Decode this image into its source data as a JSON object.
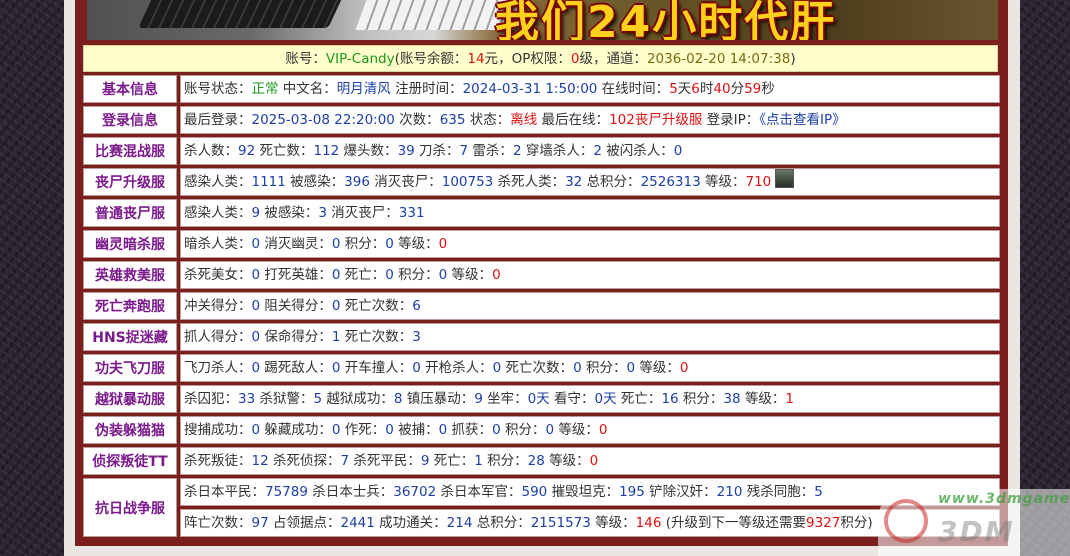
{
  "banner": {
    "text": "我们24小时代肝"
  },
  "account": {
    "prefix": "账号：",
    "id": "VIP-Candy",
    "balance_label": "(账号余额：",
    "balance": "14",
    "balance_unit": "元，OP权限：",
    "op": "0",
    "op_unit": "级，通道：",
    "channel": "2036-02-20 14:07:38",
    "suffix": ")"
  },
  "rows": [
    {
      "label": "基本信息",
      "lines": [
        [
          {
            "t": "账号状态："
          },
          {
            "t": "正常",
            "c": "green"
          },
          {
            "t": " 中文名："
          },
          {
            "t": "明月清风",
            "c": "blue"
          },
          {
            "t": " 注册时间："
          },
          {
            "t": "2024-03-31 1:50:00",
            "c": "blue"
          },
          {
            "t": " 在线时间："
          },
          {
            "t": "5",
            "c": "red"
          },
          {
            "t": "天"
          },
          {
            "t": "6",
            "c": "red"
          },
          {
            "t": "时"
          },
          {
            "t": "40",
            "c": "red"
          },
          {
            "t": "分"
          },
          {
            "t": "59",
            "c": "red"
          },
          {
            "t": "秒"
          }
        ]
      ]
    },
    {
      "label": "登录信息",
      "lines": [
        [
          {
            "t": "最后登录："
          },
          {
            "t": "2025-03-08 22:20:00",
            "c": "blue"
          },
          {
            "t": " 次数："
          },
          {
            "t": "635",
            "c": "blue"
          },
          {
            "t": " 状态："
          },
          {
            "t": "离线",
            "c": "red"
          },
          {
            "t": " 最后在线："
          },
          {
            "t": "102丧尸升级服",
            "c": "red"
          },
          {
            "t": " 登录IP："
          },
          {
            "t": "《点击查看IP》",
            "c": "link"
          }
        ]
      ]
    },
    {
      "label": "比赛混战服",
      "lines": [
        [
          {
            "t": "杀人数："
          },
          {
            "t": "92",
            "c": "blue"
          },
          {
            "t": " 死亡数："
          },
          {
            "t": "112",
            "c": "blue"
          },
          {
            "t": " 爆头数："
          },
          {
            "t": "39",
            "c": "blue"
          },
          {
            "t": " 刀杀："
          },
          {
            "t": "7",
            "c": "blue"
          },
          {
            "t": " 雷杀："
          },
          {
            "t": "2",
            "c": "blue"
          },
          {
            "t": " 穿墙杀人："
          },
          {
            "t": "2",
            "c": "blue"
          },
          {
            "t": " 被闪杀人："
          },
          {
            "t": "0",
            "c": "blue"
          }
        ]
      ]
    },
    {
      "label": "丧尸升级服",
      "avatar": true,
      "lines": [
        [
          {
            "t": "感染人类："
          },
          {
            "t": "1111",
            "c": "blue"
          },
          {
            "t": " 被感染："
          },
          {
            "t": "396",
            "c": "blue"
          },
          {
            "t": " 消灭丧尸："
          },
          {
            "t": "100753",
            "c": "blue"
          },
          {
            "t": " 杀死人类："
          },
          {
            "t": "32",
            "c": "blue"
          },
          {
            "t": " 总积分："
          },
          {
            "t": "2526313",
            "c": "blue"
          },
          {
            "t": " 等级："
          },
          {
            "t": "710",
            "c": "red"
          }
        ]
      ]
    },
    {
      "label": "普通丧尸服",
      "lines": [
        [
          {
            "t": "感染人类："
          },
          {
            "t": "9",
            "c": "blue"
          },
          {
            "t": " 被感染："
          },
          {
            "t": "3",
            "c": "blue"
          },
          {
            "t": " 消灭丧尸："
          },
          {
            "t": "331",
            "c": "blue"
          }
        ]
      ]
    },
    {
      "label": "幽灵暗杀服",
      "lines": [
        [
          {
            "t": "暗杀人类："
          },
          {
            "t": "0",
            "c": "blue"
          },
          {
            "t": " 消灭幽灵："
          },
          {
            "t": "0",
            "c": "blue"
          },
          {
            "t": " 积分："
          },
          {
            "t": "0",
            "c": "blue"
          },
          {
            "t": " 等级："
          },
          {
            "t": "0",
            "c": "red"
          }
        ]
      ]
    },
    {
      "label": "英雄救美服",
      "lines": [
        [
          {
            "t": "杀死美女："
          },
          {
            "t": "0",
            "c": "blue"
          },
          {
            "t": " 打死英雄："
          },
          {
            "t": "0",
            "c": "blue"
          },
          {
            "t": " 死亡："
          },
          {
            "t": "0",
            "c": "blue"
          },
          {
            "t": " 积分："
          },
          {
            "t": "0",
            "c": "blue"
          },
          {
            "t": " 等级："
          },
          {
            "t": "0",
            "c": "red"
          }
        ]
      ]
    },
    {
      "label": "死亡奔跑服",
      "lines": [
        [
          {
            "t": "冲关得分："
          },
          {
            "t": "0",
            "c": "blue"
          },
          {
            "t": " 阻关得分："
          },
          {
            "t": "0",
            "c": "blue"
          },
          {
            "t": " 死亡次数："
          },
          {
            "t": "6",
            "c": "blue"
          }
        ]
      ]
    },
    {
      "label": "HNS捉迷藏",
      "lines": [
        [
          {
            "t": "抓人得分："
          },
          {
            "t": "0",
            "c": "blue"
          },
          {
            "t": " 保命得分："
          },
          {
            "t": "1",
            "c": "blue"
          },
          {
            "t": " 死亡次数："
          },
          {
            "t": "3",
            "c": "blue"
          }
        ]
      ]
    },
    {
      "label": "功夫飞刀服",
      "lines": [
        [
          {
            "t": "飞刀杀人："
          },
          {
            "t": "0",
            "c": "blue"
          },
          {
            "t": " 踢死敌人："
          },
          {
            "t": "0",
            "c": "blue"
          },
          {
            "t": " 开车撞人："
          },
          {
            "t": "0",
            "c": "blue"
          },
          {
            "t": " 开枪杀人："
          },
          {
            "t": "0",
            "c": "blue"
          },
          {
            "t": " 死亡次数："
          },
          {
            "t": "0",
            "c": "blue"
          },
          {
            "t": " 积分："
          },
          {
            "t": "0",
            "c": "blue"
          },
          {
            "t": " 等级："
          },
          {
            "t": "0",
            "c": "red"
          }
        ]
      ]
    },
    {
      "label": "越狱暴动服",
      "lines": [
        [
          {
            "t": "杀囚犯："
          },
          {
            "t": "33",
            "c": "blue"
          },
          {
            "t": " 杀狱警："
          },
          {
            "t": "5",
            "c": "blue"
          },
          {
            "t": " 越狱成功："
          },
          {
            "t": "8",
            "c": "blue"
          },
          {
            "t": " 镇压暴动："
          },
          {
            "t": "9",
            "c": "blue"
          },
          {
            "t": " 坐牢："
          },
          {
            "t": "0天",
            "c": "blue"
          },
          {
            "t": " 看守："
          },
          {
            "t": "0天",
            "c": "blue"
          },
          {
            "t": " 死亡："
          },
          {
            "t": "16",
            "c": "blue"
          },
          {
            "t": " 积分："
          },
          {
            "t": "38",
            "c": "blue"
          },
          {
            "t": " 等级："
          },
          {
            "t": "1",
            "c": "red"
          }
        ]
      ]
    },
    {
      "label": "伪装躲猫猫",
      "lines": [
        [
          {
            "t": "搜捕成功："
          },
          {
            "t": "0",
            "c": "blue"
          },
          {
            "t": " 躲藏成功："
          },
          {
            "t": "0",
            "c": "blue"
          },
          {
            "t": " 作死："
          },
          {
            "t": "0",
            "c": "blue"
          },
          {
            "t": " 被捕："
          },
          {
            "t": "0",
            "c": "blue"
          },
          {
            "t": " 抓获："
          },
          {
            "t": "0",
            "c": "blue"
          },
          {
            "t": " 积分："
          },
          {
            "t": "0",
            "c": "blue"
          },
          {
            "t": " 等级："
          },
          {
            "t": "0",
            "c": "red"
          }
        ]
      ]
    },
    {
      "label": "侦探叛徒TT",
      "lines": [
        [
          {
            "t": "杀死叛徒："
          },
          {
            "t": "12",
            "c": "blue"
          },
          {
            "t": " 杀死侦探："
          },
          {
            "t": "7",
            "c": "blue"
          },
          {
            "t": " 杀死平民："
          },
          {
            "t": "9",
            "c": "blue"
          },
          {
            "t": " 死亡："
          },
          {
            "t": "1",
            "c": "blue"
          },
          {
            "t": " 积分："
          },
          {
            "t": "28",
            "c": "blue"
          },
          {
            "t": " 等级："
          },
          {
            "t": "0",
            "c": "red"
          }
        ]
      ]
    },
    {
      "label": "抗日战争服",
      "lines": [
        [
          {
            "t": "杀日本平民："
          },
          {
            "t": "75789",
            "c": "blue"
          },
          {
            "t": " 杀日本士兵："
          },
          {
            "t": "36702",
            "c": "blue"
          },
          {
            "t": " 杀日本军官："
          },
          {
            "t": "590",
            "c": "blue"
          },
          {
            "t": " 摧毁坦克："
          },
          {
            "t": "195",
            "c": "blue"
          },
          {
            "t": " 铲除汉奸："
          },
          {
            "t": "210",
            "c": "blue"
          },
          {
            "t": " 残杀同胞："
          },
          {
            "t": "5",
            "c": "blue"
          }
        ],
        [
          {
            "t": "阵亡次数："
          },
          {
            "t": "97",
            "c": "blue"
          },
          {
            "t": " 占领据点："
          },
          {
            "t": "2441",
            "c": "blue"
          },
          {
            "t": " 成功通关："
          },
          {
            "t": "214",
            "c": "blue"
          },
          {
            "t": " 总积分："
          },
          {
            "t": "2151573",
            "c": "blue"
          },
          {
            "t": " 等级："
          },
          {
            "t": "146",
            "c": "red"
          },
          {
            "t": " (升级到下一等级还需要"
          },
          {
            "t": "9327",
            "c": "red"
          },
          {
            "t": "积分)"
          }
        ]
      ]
    }
  ],
  "watermark": {
    "top": "www.3dmgame.com",
    "bottom": "3DM"
  },
  "colors": {
    "label": "#7b1a8c",
    "value": "#1c3fa8",
    "highlight": "#e01010",
    "ok": "#1a9a1a",
    "border": "#7a1e1e",
    "account_bg": "#ffffcc"
  }
}
